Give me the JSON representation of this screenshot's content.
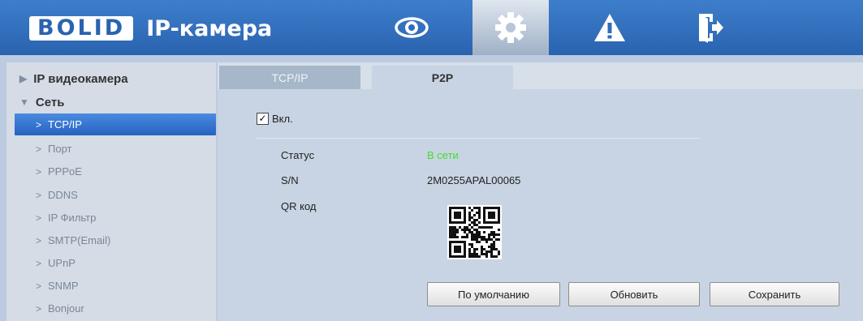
{
  "header": {
    "logo_text": "BOLID",
    "title": "IP-камера",
    "nav": [
      {
        "icon": "eye-icon"
      },
      {
        "icon": "gear-icon"
      },
      {
        "icon": "warning-icon"
      },
      {
        "icon": "logout-icon"
      }
    ],
    "active_nav": "gear-icon"
  },
  "sidebar": {
    "groups": [
      {
        "label": "IP видеокамера",
        "expanded": false
      },
      {
        "label": "Сеть",
        "expanded": true
      }
    ],
    "items": [
      {
        "label": "TCP/IP",
        "active": true
      },
      {
        "label": "Порт"
      },
      {
        "label": "PPPoE"
      },
      {
        "label": "DDNS"
      },
      {
        "label": "IP Фильтр"
      },
      {
        "label": "SMTP(Email)"
      },
      {
        "label": "UPnP"
      },
      {
        "label": "SNMP"
      },
      {
        "label": "Bonjour"
      }
    ]
  },
  "tabs": [
    {
      "label": "TCP/IP",
      "active": false
    },
    {
      "label": "P2P",
      "active": true
    }
  ],
  "p2p": {
    "enable_label": "Вкл.",
    "enabled": true,
    "status_label": "Статус",
    "status_value": "В сети",
    "sn_label": "S/N",
    "sn_value": "2M0255APAL00065",
    "qr_label": "QR код"
  },
  "buttons": {
    "default": "По умолчанию",
    "refresh": "Обновить",
    "save": "Сохранить"
  },
  "colors": {
    "header": "#2f6dbb",
    "accent": "#3a79d4",
    "status_online": "#3fdf2a"
  }
}
